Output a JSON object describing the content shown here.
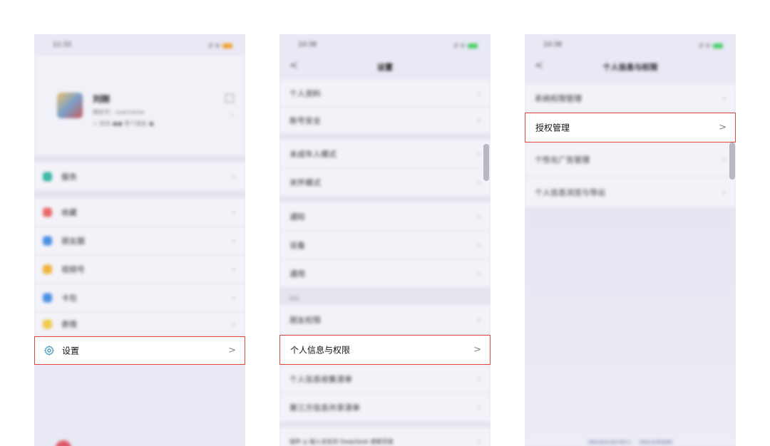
{
  "panel1": {
    "status": {
      "time": "11:33",
      "icons": "ıl ᯤ"
    },
    "profile": {
      "name": "刘刚",
      "id_line": "微信号：username",
      "status_line": "+ 状态   ●● 等个朋友 ●"
    },
    "groups": [
      [
        {
          "label": "服务",
          "color": "#3fb6a8"
        }
      ],
      [
        {
          "label": "收藏",
          "color": "#e66a6a"
        },
        {
          "label": "朋友圈",
          "color": "#4a90e2"
        },
        {
          "label": "视频号",
          "color": "#f2b33d"
        },
        {
          "label": "卡包",
          "color": "#4a90e2"
        },
        {
          "label": "表情",
          "color": "#f2c94c"
        }
      ]
    ],
    "highlight": {
      "label": "设置",
      "chevron": ">"
    }
  },
  "panel2": {
    "status": {
      "time": "10:38",
      "icons": "ıl ᯤ"
    },
    "nav": {
      "back": "<",
      "title": "设置"
    },
    "groups": [
      [
        "个人资料",
        "账号安全"
      ],
      [
        "未成年人模式",
        "关怀模式"
      ],
      [
        "通知",
        "设备",
        "通用"
      ],
      [
        "朋友权限"
      ]
    ],
    "section_label": "隐私",
    "highlight": {
      "label": "个人信息与权限",
      "chevron": ">"
    },
    "after": [
      "个人信息收集清单",
      "第三方信息共享清单",
      "插件   ◎    输入法支持 DeepSeek 搜索百度"
    ]
  },
  "panel3": {
    "status": {
      "time": "10:38",
      "icons": "ıl ᯤ"
    },
    "nav": {
      "back": "<",
      "title": "个人信息与权限"
    },
    "rows_before": [
      "系统权限管理"
    ],
    "highlight": {
      "label": "授权管理",
      "chevron": ">"
    },
    "rows_after": [
      "个性化广告管理",
      "个人信息浏览与导出"
    ],
    "footer": "《微信隐私保护指引》 《隐私政策摘要》"
  }
}
